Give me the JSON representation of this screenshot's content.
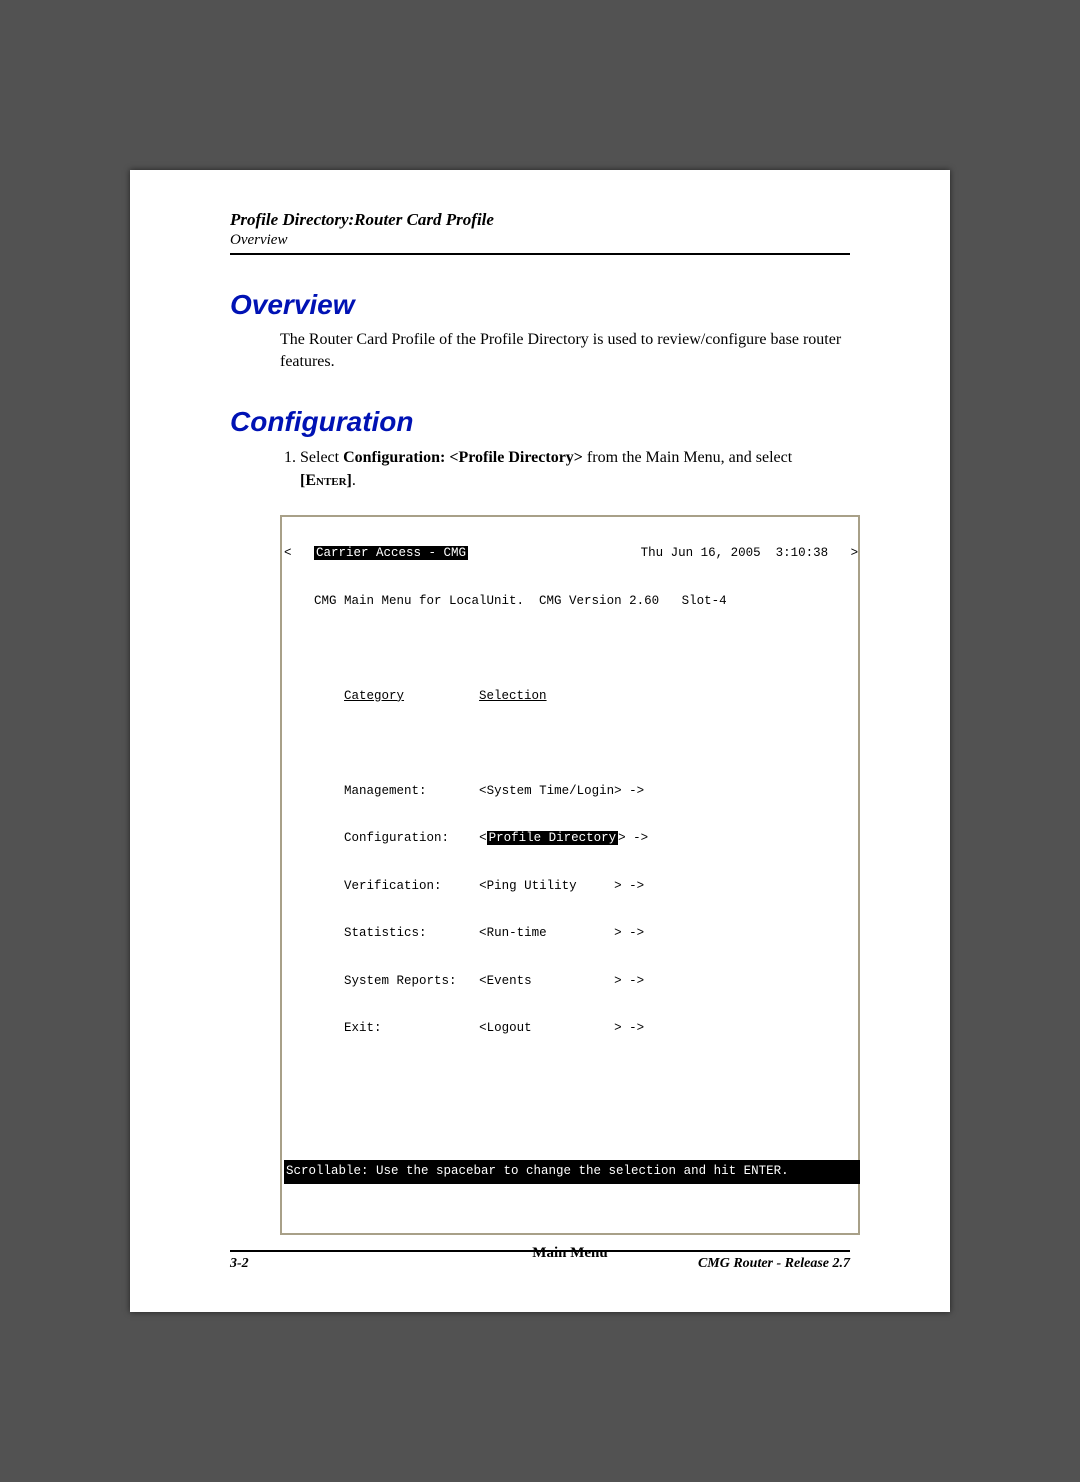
{
  "header": {
    "title": "Profile Directory:Router Card Profile",
    "subtitle": "Overview"
  },
  "sections": {
    "overview": {
      "heading": "Overview",
      "paragraph": "The Router Card Profile of the Profile Directory is used to review/configure base router features."
    },
    "configuration": {
      "heading": "Configuration",
      "step_prefix": "Select ",
      "step_bold1": "Configuration: <Profile Directory>",
      "step_mid": " from the Main Menu, and select ",
      "step_enter": "[Enter]",
      "step_suffix": "."
    }
  },
  "terminal": {
    "top_left": "Carrier Access - CMG",
    "top_right": "Thu Jun 16, 2005  3:10:38",
    "line2": "CMG Main Menu for LocalUnit.  CMG Version 2.60   Slot-4",
    "col_category": "Category",
    "col_selection": "Selection",
    "rows": [
      {
        "cat": "Management:",
        "sel_pre": "<",
        "sel": "System Time/Login",
        "sel_post": "> ->",
        "hl": false
      },
      {
        "cat": "Configuration:",
        "sel_pre": "<",
        "sel": "Profile Directory",
        "sel_post": "> ->",
        "hl": true
      },
      {
        "cat": "Verification:",
        "sel_pre": "<",
        "sel": "Ping Utility     ",
        "sel_post": "> ->",
        "hl": false
      },
      {
        "cat": "Statistics:",
        "sel_pre": "<",
        "sel": "Run-time         ",
        "sel_post": "> ->",
        "hl": false
      },
      {
        "cat": "System Reports:",
        "sel_pre": "<",
        "sel": "Events           ",
        "sel_post": "> ->",
        "hl": false
      },
      {
        "cat": "Exit:",
        "sel_pre": "<",
        "sel": "Logout           ",
        "sel_post": "> ->",
        "hl": false
      }
    ],
    "bottom": "Scrollable: Use the spacebar to change the selection and hit ENTER."
  },
  "caption": "Main Menu",
  "footer": {
    "left": "3-2",
    "right": "CMG Router - Release 2.7"
  }
}
